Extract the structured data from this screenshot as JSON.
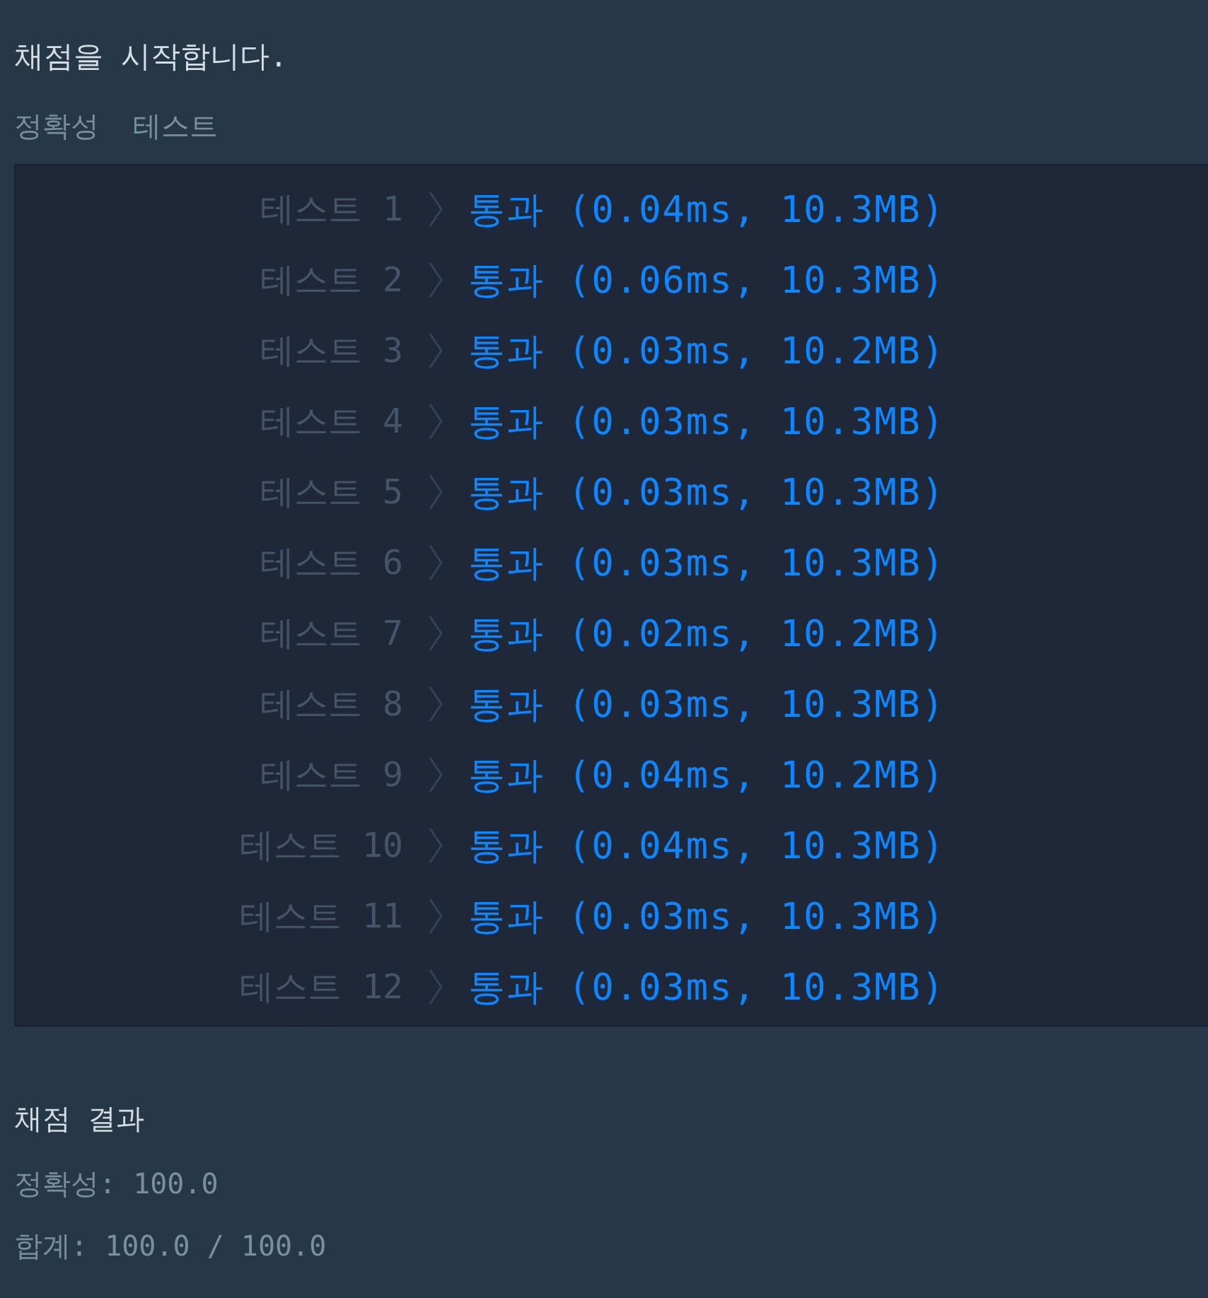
{
  "header": "채점을 시작합니다.",
  "section_title": "정확성  테스트",
  "tests": [
    {
      "label": "테스트 1",
      "result": "통과 (0.04ms, 10.3MB)"
    },
    {
      "label": "테스트 2",
      "result": "통과 (0.06ms, 10.3MB)"
    },
    {
      "label": "테스트 3",
      "result": "통과 (0.03ms, 10.2MB)"
    },
    {
      "label": "테스트 4",
      "result": "통과 (0.03ms, 10.3MB)"
    },
    {
      "label": "테스트 5",
      "result": "통과 (0.03ms, 10.3MB)"
    },
    {
      "label": "테스트 6",
      "result": "통과 (0.03ms, 10.3MB)"
    },
    {
      "label": "테스트 7",
      "result": "통과 (0.02ms, 10.2MB)"
    },
    {
      "label": "테스트 8",
      "result": "통과 (0.03ms, 10.3MB)"
    },
    {
      "label": "테스트 9",
      "result": "통과 (0.04ms, 10.2MB)"
    },
    {
      "label": "테스트 10",
      "result": "통과 (0.04ms, 10.3MB)"
    },
    {
      "label": "테스트 11",
      "result": "통과 (0.03ms, 10.3MB)"
    },
    {
      "label": "테스트 12",
      "result": "통과 (0.03ms, 10.3MB)"
    }
  ],
  "summary": {
    "title": "채점 결과",
    "lines": [
      "정확성: 100.0",
      "합계: 100.0 / 100.0"
    ]
  }
}
